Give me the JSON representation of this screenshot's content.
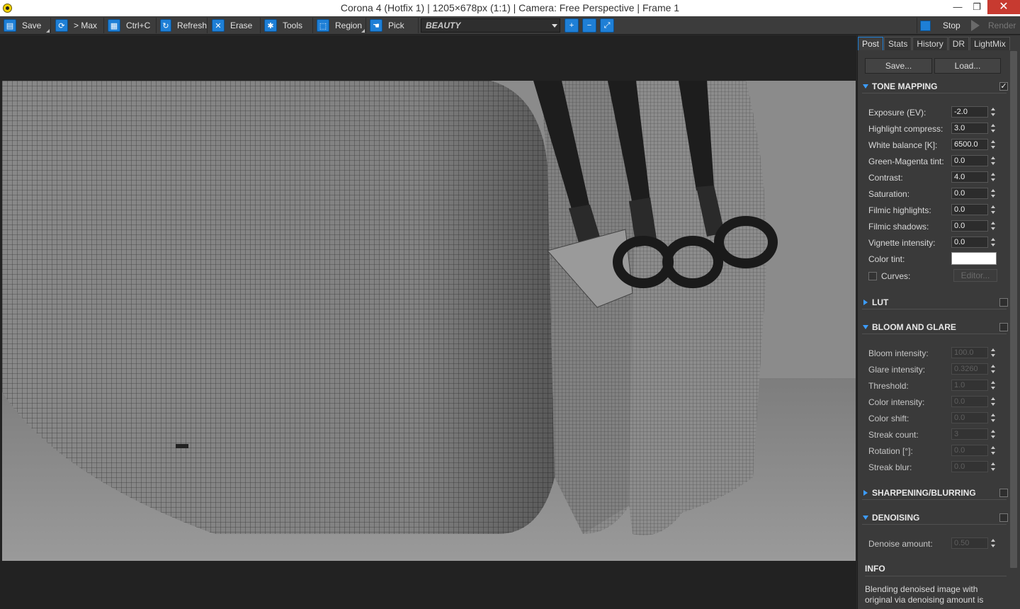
{
  "window": {
    "title": "Corona 4 (Hotfix 1) | 1205×678px (1:1) | Camera: Free Perspective | Frame 1",
    "minimize": "—",
    "maximize": "❐",
    "close": "✕"
  },
  "toolbar": {
    "save": "Save",
    "max": "> Max",
    "copy": "Ctrl+C",
    "refresh": "Refresh",
    "erase": "Erase",
    "tools": "Tools",
    "region": "Region",
    "pick": "Pick",
    "channel": "BEAUTY",
    "stop": "Stop",
    "render": "Render",
    "accent_color": "#1e7fd6"
  },
  "panel": {
    "tabs": [
      "Post",
      "Stats",
      "History",
      "DR",
      "LightMix"
    ],
    "active_tab": "Post",
    "save_button": "Save...",
    "load_button": "Load...",
    "tone_mapping": {
      "title": "TONE MAPPING",
      "enabled": "✓",
      "rows": [
        {
          "label": "Exposure (EV):",
          "value": "-2.0"
        },
        {
          "label": "Highlight compress:",
          "value": "3.0"
        },
        {
          "label": "White balance [K]:",
          "value": "6500.0"
        },
        {
          "label": "Green-Magenta tint:",
          "value": "0.0"
        },
        {
          "label": "Contrast:",
          "value": "4.0"
        },
        {
          "label": "Saturation:",
          "value": "0.0"
        },
        {
          "label": "Filmic highlights:",
          "value": "0.0"
        },
        {
          "label": "Filmic shadows:",
          "value": "0.0"
        },
        {
          "label": "Vignette intensity:",
          "value": "0.0"
        }
      ],
      "color_tint_label": "Color tint:",
      "color_tint_value": "#ffffff",
      "curves_label": "Curves:",
      "editor_label": "Editor..."
    },
    "lut": {
      "title": "LUT"
    },
    "bloom": {
      "title": "BLOOM AND GLARE",
      "rows": [
        {
          "label": "Bloom intensity:",
          "value": "100.0"
        },
        {
          "label": "Glare intensity:",
          "value": "0.3260"
        },
        {
          "label": "Threshold:",
          "value": "1.0"
        },
        {
          "label": "Color intensity:",
          "value": "0.0"
        },
        {
          "label": "Color shift:",
          "value": "0.0"
        },
        {
          "label": "Streak count:",
          "value": "3"
        },
        {
          "label": "Rotation [°]:",
          "value": "0.0"
        },
        {
          "label": "Streak blur:",
          "value": "0.0"
        }
      ]
    },
    "sharpening": {
      "title": "SHARPENING/BLURRING"
    },
    "denoising": {
      "title": "DENOISING",
      "amount_label": "Denoise amount:",
      "amount_value": "0.50"
    },
    "info": {
      "title": "INFO",
      "text": "Blending denoised image with original via denoising amount is"
    }
  }
}
